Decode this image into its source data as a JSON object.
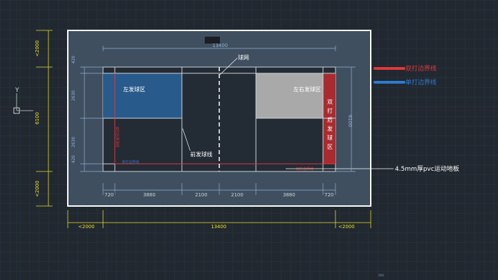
{
  "colors": {
    "background": "#212830",
    "grid": "#2c3640",
    "frame_fill": "#3f4f5f",
    "court_fill": "#232b35",
    "left_service_fill": "#285a8c",
    "right_service_fill": "#a9a9a9",
    "rear_service_fill": "#a82c2f",
    "yellow_dim": "#e8e02a",
    "legend_red": "#e0383c",
    "legend_blue": "#2f7bd0"
  },
  "labels": {
    "net": "球网",
    "left_service": "左发球区",
    "right_service": "左右发球区",
    "rear_service": [
      "双",
      "打",
      "后",
      "发",
      "球",
      "区"
    ],
    "front_service_line": "前发球线",
    "floor": "4.5mm厚pvc运动地板",
    "doubles_sideline_red": "双打边界线",
    "singles_sideline_blue": "单打边界线",
    "small_red_bottom": "双打边界线",
    "small_blue_bottom": "单打边界线",
    "small_red_left": "双打后发球线",
    "axis_y": "Y"
  },
  "legend": {
    "red_label": "双打边界线",
    "blue_label": "单打边界线"
  },
  "dimensions": {
    "top_width": "13400",
    "bottom_width": "13400",
    "bottom_left": "<2000",
    "bottom_right": "<2000",
    "left_top": "<2000",
    "left_mid": "6100",
    "left_bottom": "<2000",
    "inner_left": [
      "420",
      "2630",
      "2630",
      "420"
    ],
    "inner_right": "6100",
    "bottom_segments": [
      "720",
      "3880",
      "2100",
      "2100",
      "3880",
      "720"
    ]
  }
}
